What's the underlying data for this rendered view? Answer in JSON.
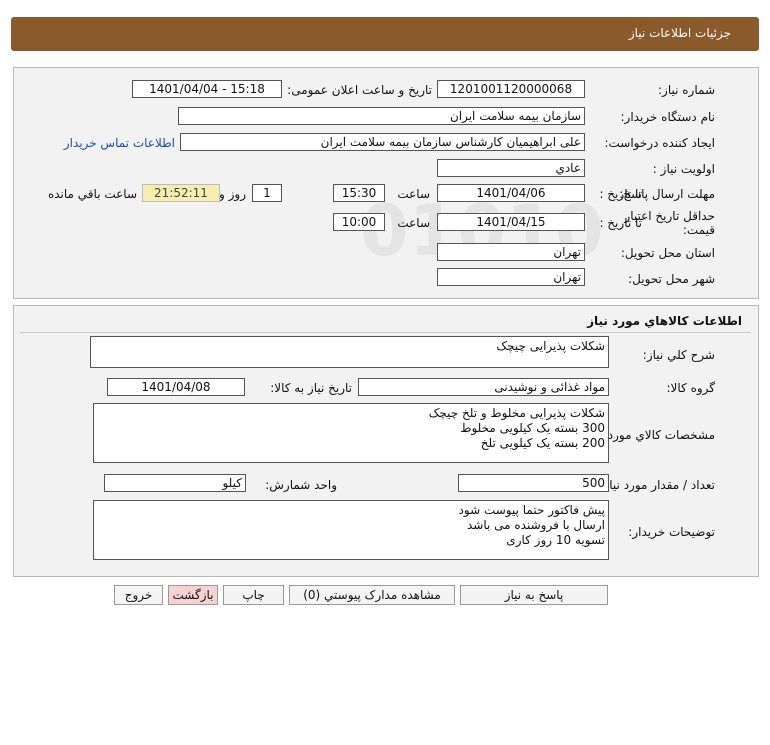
{
  "header": {
    "title": "جزئیات اطلاعات نیاز"
  },
  "request": {
    "need_number_label": "شماره نیاز:",
    "need_number": "1201001120000068",
    "announce_label": "تاریخ و ساعت اعلان عمومی:",
    "announce_value": "1401/04/04 - 15:18",
    "buyer_org_label": "نام دستگاه خریدار:",
    "buyer_org": "سازمان بیمه سلامت ایران",
    "creator_label": "ایجاد کننده درخواست:",
    "creator": "علی ابراهیمیان کارشناس سازمان بیمه سلامت ایران",
    "contact_link": "اطلاعات تماس خریدار",
    "priority_label": "اولویت نیاز :",
    "priority": "عادي",
    "deadline_label": "مهلت ارسال پاسخ:",
    "to_date_label": "تا تاریخ :",
    "deadline_date": "1401/04/06",
    "time_label": "ساعت",
    "deadline_time": "15:30",
    "remaining_days": "1",
    "days_label": "روز و",
    "remaining_time": "21:52:11",
    "remaining_label": "ساعت باقي مانده",
    "validity_label": "حداقل تاریخ اعتبار قیمت:",
    "validity_date": "1401/04/15",
    "validity_time": "10:00",
    "province_label": "استان محل تحویل:",
    "province": "تهران",
    "city_label": "شهر محل تحویل:",
    "city": "تهران"
  },
  "goods": {
    "section_title": "اطلاعات کالاهاي مورد نیاز",
    "desc_label": "شرح کلي نیاز:",
    "desc": "شکلات پذیرایی چیچک",
    "group_label": "گروه کالا:",
    "group": "مواد غذائی و نوشیدنی",
    "need_date_label": "تاریخ نیاز به کالا:",
    "need_date": "1401/04/08",
    "specs_label": "مشخصات کالاي مورد نیاز:",
    "specs": [
      "شکلات پذیرایی مخلوط و تلخ چیچک",
      "300 بسته یک کیلویی مخلوط",
      "200 بسته یک کیلویی تلخ"
    ],
    "qty_label": "تعداد / مقدار مورد نیاز:",
    "qty": "500",
    "unit_label": "واحد شمارش:",
    "unit": "کیلو",
    "notes_label": "توضیحات خریدار:",
    "notes": [
      "پیش فاکتور حتما پیوست شود",
      "ارسال با فروشنده می باشد",
      "تسویه 10 روز کاری"
    ]
  },
  "buttons": {
    "reply": "پاسخ به نیاز",
    "attachments": "مشاهده مدارک پیوستي (0)",
    "print": "چاپ",
    "back": "بازگشت",
    "exit": "خروج"
  },
  "colors": {
    "header_bg": "#8b5a2b",
    "panel_bg": "#f2f2f2",
    "time_bg": "#f5eeae",
    "back_btn": "#f6d2d2",
    "link": "#1a4fb3"
  }
}
